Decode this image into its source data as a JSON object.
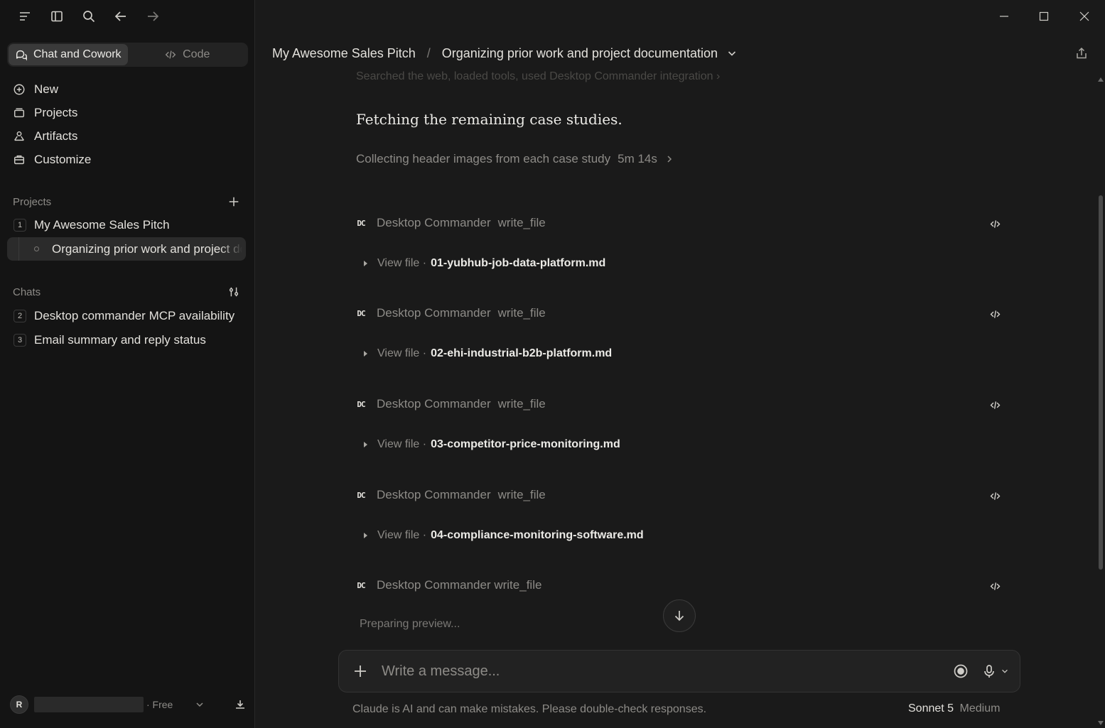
{
  "sidebar": {
    "mode_tabs": [
      {
        "label": "Chat and Cowork",
        "active": true
      },
      {
        "label": "Code",
        "active": false
      }
    ],
    "nav": [
      {
        "label": "New",
        "icon": "plus-circle-icon"
      },
      {
        "label": "Projects",
        "icon": "folder-icon"
      },
      {
        "label": "Artifacts",
        "icon": "artifacts-icon"
      },
      {
        "label": "Customize",
        "icon": "briefcase-icon"
      }
    ],
    "projects_heading": "Projects",
    "projects": [
      {
        "index": "1",
        "label": "My Awesome Sales Pitch"
      }
    ],
    "active_chat": "Organizing prior work and project documentation",
    "chats_heading": "Chats",
    "chats": [
      {
        "index": "2",
        "label": "Desktop commander MCP availability"
      },
      {
        "index": "3",
        "label": "Email summary and reply status"
      }
    ],
    "user": {
      "initial": "R",
      "plan": "· Free"
    }
  },
  "header": {
    "project": "My Awesome Sales Pitch",
    "separator": "/",
    "chat_title": "Organizing prior work and project documentation"
  },
  "conversation": {
    "faded_summary": "Searched the web, loaded tools, used Desktop Commander integration",
    "status_message": "Fetching the remaining case studies.",
    "activity": {
      "label": "Collecting header images from each case study",
      "duration": "5m 14s"
    },
    "tool_calls": [
      {
        "tool": "Desktop Commander",
        "action": "write_file",
        "view_label": "View file ·",
        "file": "01-yubhub-job-data-platform.md"
      },
      {
        "tool": "Desktop Commander",
        "action": "write_file",
        "view_label": "View file ·",
        "file": "02-ehi-industrial-b2b-platform.md"
      },
      {
        "tool": "Desktop Commander",
        "action": "write_file",
        "view_label": "View file ·",
        "file": "03-competitor-price-monitoring.md"
      },
      {
        "tool": "Desktop Commander",
        "action": "write_file",
        "view_label": "View file ·",
        "file": "04-compliance-monitoring-software.md"
      }
    ],
    "pending_tool": {
      "label": "Desktop Commander write_file"
    },
    "preparing": "Preparing preview..."
  },
  "composer": {
    "placeholder": "Write a message..."
  },
  "footer": {
    "disclaimer": "Claude is AI and can make mistakes. Please double-check responses.",
    "model": "Sonnet 5",
    "effort": "Medium"
  },
  "colors": {
    "sidebar_bg": "#141414",
    "main_bg": "#1a1a1a",
    "text_primary": "#e3e1dc",
    "text_muted": "#8d8b87"
  }
}
